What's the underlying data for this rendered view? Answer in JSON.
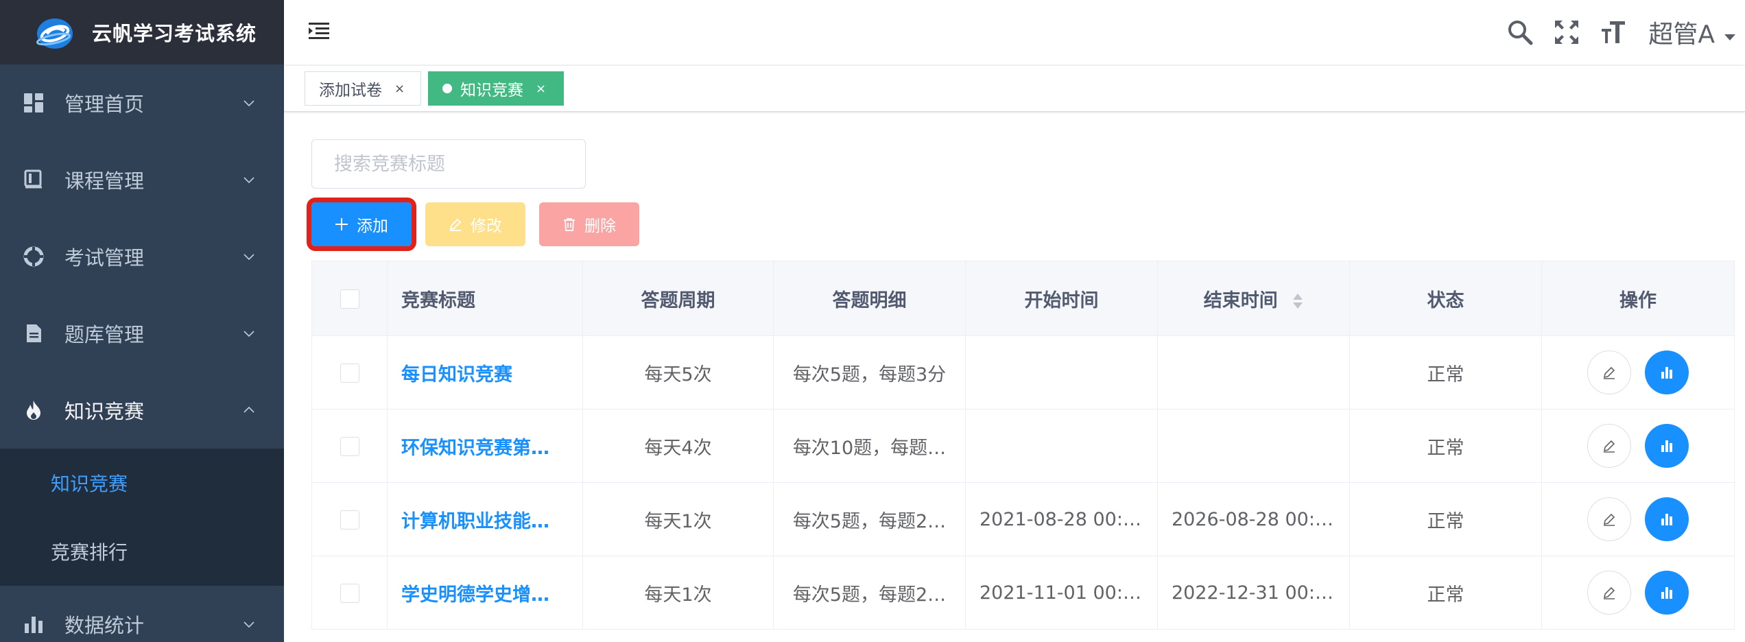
{
  "app": {
    "title": "云帆学习考试系统"
  },
  "sidebar": {
    "items": [
      {
        "label": "管理首页",
        "icon": "dashboard-icon",
        "expanded": false
      },
      {
        "label": "课程管理",
        "icon": "book-icon",
        "expanded": false
      },
      {
        "label": "考试管理",
        "icon": "exam-icon",
        "expanded": false
      },
      {
        "label": "题库管理",
        "icon": "document-icon",
        "expanded": false
      },
      {
        "label": "知识竞赛",
        "icon": "fire-icon",
        "expanded": true,
        "children": [
          {
            "label": "知识竞赛",
            "active": true
          },
          {
            "label": "竞赛排行",
            "active": false
          }
        ]
      },
      {
        "label": "数据统计",
        "icon": "bar-chart-icon",
        "expanded": false
      }
    ]
  },
  "navbar": {
    "user_name": "超管A",
    "icons": [
      "search-icon",
      "fullscreen-icon",
      "font-size-icon"
    ]
  },
  "tags": [
    {
      "label": "添加试卷",
      "active": false
    },
    {
      "label": "知识竞赛",
      "active": true
    }
  ],
  "search": {
    "placeholder": "搜索竞赛标题",
    "value": ""
  },
  "toolbar": {
    "add_label": "添加",
    "edit_label": "修改",
    "delete_label": "删除"
  },
  "table": {
    "columns": [
      "竞赛标题",
      "答题周期",
      "答题明细",
      "开始时间",
      "结束时间",
      "状态",
      "操作"
    ],
    "sortable_column": "结束时间",
    "rows": [
      {
        "title": "每日知识竞赛",
        "cycle": "每天5次",
        "detail": "每次5题，每题3分",
        "start": "",
        "end": "",
        "status": "正常"
      },
      {
        "title": "环保知识竞赛第…",
        "cycle": "每天4次",
        "detail": "每次10题，每题…",
        "start": "",
        "end": "",
        "status": "正常"
      },
      {
        "title": "计算机职业技能…",
        "cycle": "每天1次",
        "detail": "每次5题，每题2…",
        "start": "2021-08-28 00:0…",
        "end": "2026-08-28 00:0…",
        "status": "正常"
      },
      {
        "title": "学史明德学史增…",
        "cycle": "每天1次",
        "detail": "每次5题，每题2…",
        "start": "2021-11-01 00:0…",
        "end": "2022-12-31 00:0…",
        "status": "正常"
      }
    ]
  },
  "colors": {
    "sidebar_bg": "#304156",
    "sidebar_sub_bg": "#1f2d3d",
    "logo_bg": "#2b2f3a",
    "primary": "#1890ff",
    "tag_active": "#42b983",
    "warning_light": "#ffe08a",
    "danger_light": "#faa4a4",
    "highlight_outline": "#e0221b"
  }
}
